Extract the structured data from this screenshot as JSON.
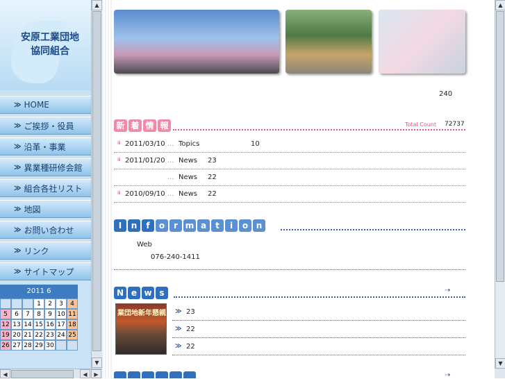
{
  "logo": {
    "text": "安原工業団地\n協同組合"
  },
  "nav": [
    {
      "label": "HOME"
    },
    {
      "label": "ご挨拶・役員"
    },
    {
      "label": "沿革・事業"
    },
    {
      "label": "異業種研修会館"
    },
    {
      "label": "組合各社リスト"
    },
    {
      "label": "地図"
    },
    {
      "label": "お問い合わせ"
    },
    {
      "label": "リンク"
    },
    {
      "label": "サイトマップ"
    }
  ],
  "calendar": {
    "title": "2011  6",
    "weeks": [
      [
        "",
        "",
        "",
        "1",
        "2",
        "3",
        "4"
      ],
      [
        "5",
        "6",
        "7",
        "8",
        "9",
        "10",
        "11"
      ],
      [
        "12",
        "13",
        "14",
        "15",
        "16",
        "17",
        "18"
      ],
      [
        "19",
        "20",
        "21",
        "22",
        "23",
        "24",
        "25"
      ],
      [
        "26",
        "27",
        "28",
        "29",
        "30",
        "",
        ""
      ]
    ]
  },
  "counter": {
    "value": "240"
  },
  "shinchaku": {
    "chars": [
      "新",
      "着",
      "情",
      "報"
    ],
    "total_label": "Total Count",
    "total_value": "72737",
    "rows": [
      {
        "mark": "ⅲ",
        "date": "2011/03/10",
        "dots": "...",
        "category": "Topics",
        "extra": "10"
      },
      {
        "mark": "ⅲ",
        "date": "2011/01/20",
        "dots": "...",
        "category": "News",
        "extra": "23"
      },
      {
        "mark": "",
        "date": "",
        "dots": "...",
        "category": "News",
        "extra": "22"
      },
      {
        "mark": "ⅲ",
        "date": "2010/09/10",
        "dots": "...",
        "category": "News",
        "extra": "22"
      }
    ]
  },
  "information": {
    "chars": [
      "I",
      "n",
      "f",
      "o",
      "r",
      "m",
      "a",
      "t",
      "i",
      "o",
      "n"
    ],
    "web": "Web",
    "tel": "076-240-1411"
  },
  "news": {
    "chars": [
      "N",
      "e",
      "w",
      "s"
    ],
    "image_caption": "業団地新年懇親",
    "items": [
      {
        "text": "23"
      },
      {
        "text": "22"
      },
      {
        "text": "22"
      }
    ],
    "more_icon": "⇢"
  },
  "colors": {
    "pink": "#f08aa8",
    "blue": "#2f6fc0",
    "nav_text": "#1b3f70"
  }
}
